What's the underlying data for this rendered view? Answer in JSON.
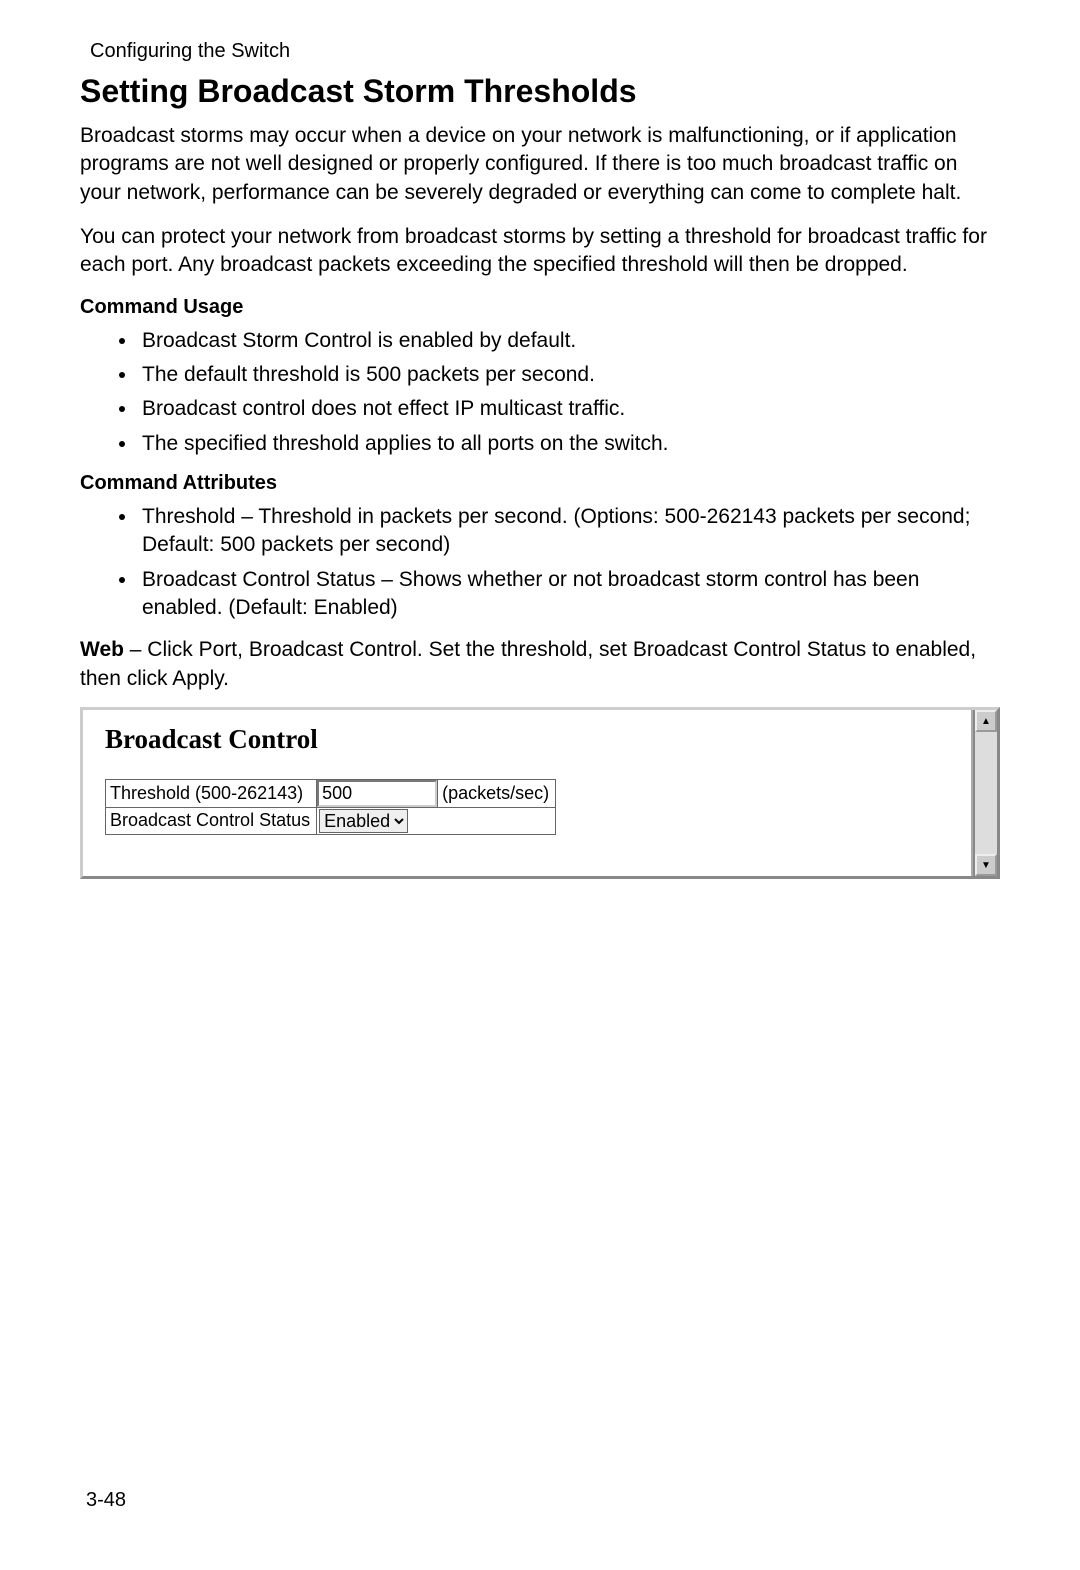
{
  "breadcrumb": "Configuring the Switch",
  "heading": "Setting Broadcast Storm Thresholds",
  "para1": "Broadcast storms may occur when a device on your network is malfunctioning, or if application programs are not well designed or properly configured. If there is too much broadcast traffic on your network, performance can be severely degraded or everything can come to complete halt.",
  "para2": "You can protect your network from broadcast storms by setting a threshold for broadcast traffic for each port. Any broadcast packets exceeding the specified threshold will then be dropped.",
  "subhead1": "Command Usage",
  "usage": [
    "Broadcast Storm Control is enabled by default.",
    "The default threshold is 500 packets per second.",
    "Broadcast control does not effect IP multicast traffic.",
    "The specified threshold applies to all ports on the switch."
  ],
  "subhead2": "Command Attributes",
  "attrs": [
    "Threshold – Threshold in packets per second. (Options: 500-262143 packets per second; Default: 500 packets per second)",
    "Broadcast Control Status – Shows whether or not broadcast storm control has been enabled. (Default: Enabled)"
  ],
  "web_bold": "Web",
  "web_rest": " – Click Port, Broadcast Control. Set the threshold, set Broadcast Control Status to enabled, then click Apply.",
  "panel": {
    "title": "Broadcast Control",
    "threshold_label": "Threshold (500-262143)",
    "threshold_value": "500",
    "threshold_unit": "(packets/sec)",
    "status_label": "Broadcast Control Status",
    "status_value": "Enabled"
  },
  "page_number": "3-48"
}
